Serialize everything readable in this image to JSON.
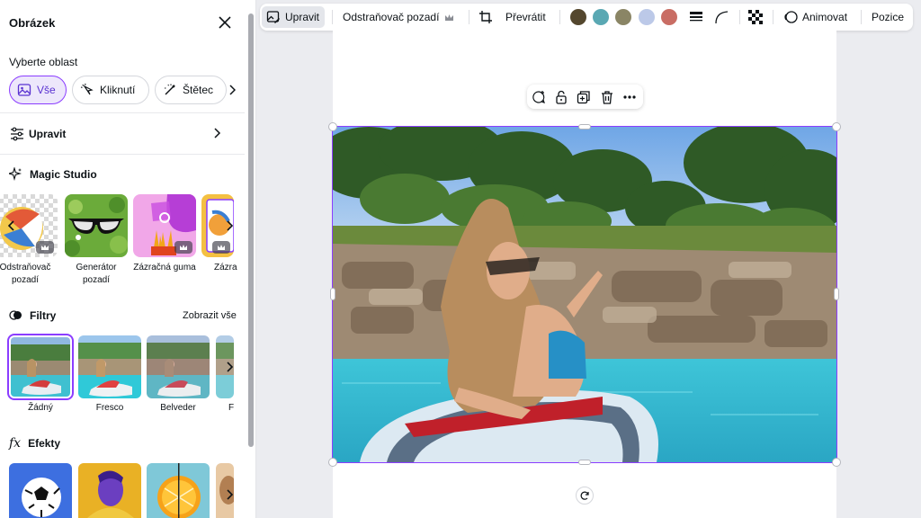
{
  "panel": {
    "title": "Obrázek",
    "select_area": {
      "label": "Vyberte oblast",
      "chips": [
        {
          "label": "Vše",
          "active": true
        },
        {
          "label": "Kliknutí",
          "active": false
        },
        {
          "label": "Štětec",
          "active": false
        }
      ]
    },
    "edit_label": "Upravit",
    "magic_studio": {
      "title": "Magic Studio",
      "tiles": [
        {
          "label": "Odstraňovač pozadí",
          "premium": true
        },
        {
          "label": "Generátor pozadí",
          "premium": false
        },
        {
          "label": "Zázračná guma",
          "premium": true
        },
        {
          "label": "Zázračné uchopení",
          "premium": true
        }
      ]
    },
    "filters": {
      "title": "Filtry",
      "see_all": "Zobrazit vše",
      "items": [
        {
          "label": "Žádný",
          "selected": true
        },
        {
          "label": "Fresco",
          "selected": false
        },
        {
          "label": "Belveder",
          "selected": false
        },
        {
          "label": "Festive",
          "selected": false
        }
      ]
    },
    "effects": {
      "title": "Efekty",
      "icon_text": "fx"
    }
  },
  "toolbar": {
    "edit_label": "Upravit",
    "bg_remove_label": "Odstraňovač pozadí",
    "flip_label": "Převrátit",
    "animate_label": "Animovat",
    "position_label": "Pozice",
    "swatches": [
      "#54472e",
      "#5aa8b3",
      "#8a8565",
      "#bcc9e8",
      "#c96d64"
    ]
  },
  "colors": {
    "accent": "#8b3dff",
    "accent_bg": "#ede7fb"
  }
}
